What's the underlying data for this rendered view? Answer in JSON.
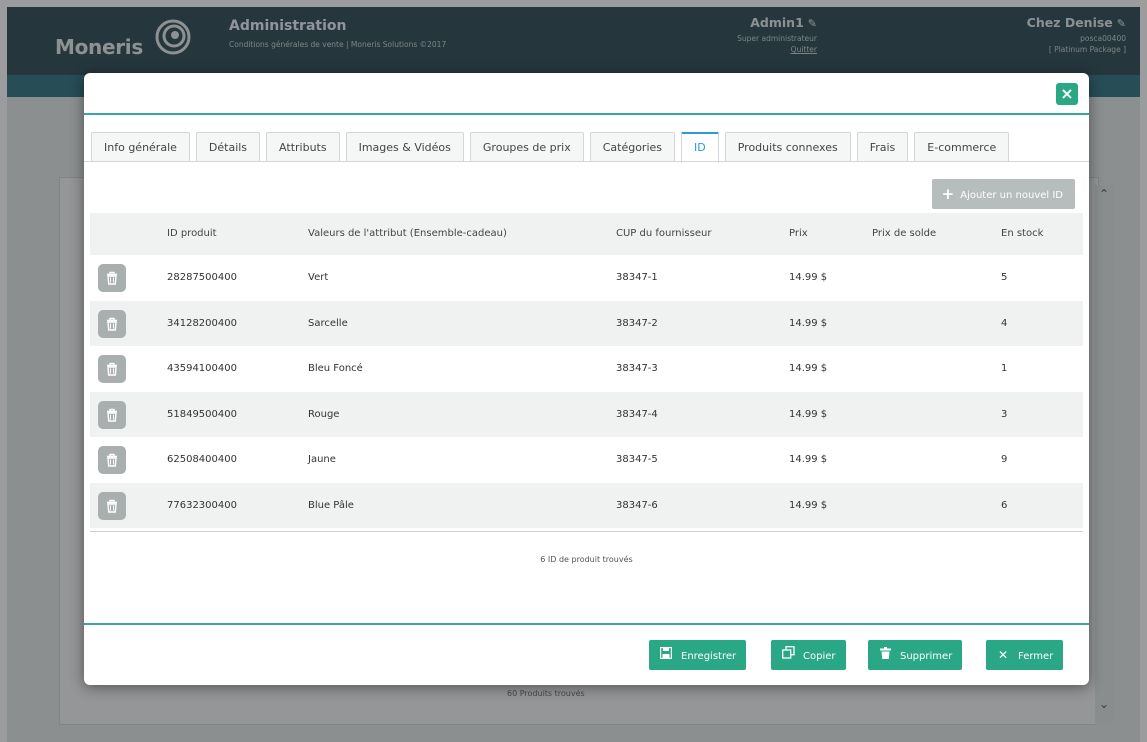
{
  "app": {
    "logo_text": "Moneris",
    "title": "Administration",
    "subtitle": "Conditions générales de vente | Moneris Solutions ©2017",
    "user": {
      "name": "Admin1",
      "role": "Super administrateur",
      "logout": "Quitter"
    },
    "store": {
      "name": "Chez Denise",
      "id": "posca00400",
      "package": "[ Platinum Package ]"
    },
    "background_found": "60 Produits trouvés"
  },
  "modal": {
    "close_label": "×",
    "tabs": [
      {
        "label": "Info générale"
      },
      {
        "label": "Détails"
      },
      {
        "label": "Attributs"
      },
      {
        "label": "Images & Vidéos"
      },
      {
        "label": "Groupes de prix"
      },
      {
        "label": "Catégories"
      },
      {
        "label": "ID",
        "active": true
      },
      {
        "label": "Produits connexes"
      },
      {
        "label": "Frais"
      },
      {
        "label": "E-commerce"
      }
    ],
    "add_button": "Ajouter un nouvel ID",
    "table": {
      "headers": {
        "id": "ID produit",
        "attr": "Valeurs de l'attribut (Ensemble-cadeau)",
        "cup": "CUP du fournisseur",
        "price": "Prix",
        "sale": "Prix de solde",
        "stock": "En stock"
      },
      "rows": [
        {
          "id": "28287500400",
          "attr": "Vert",
          "cup": "38347-1",
          "price": "14.99 $",
          "sale": "",
          "stock": "5"
        },
        {
          "id": "34128200400",
          "attr": "Sarcelle",
          "cup": "38347-2",
          "price": "14.99 $",
          "sale": "",
          "stock": "4"
        },
        {
          "id": "43594100400",
          "attr": "Bleu Foncé",
          "cup": "38347-3",
          "price": "14.99 $",
          "sale": "",
          "stock": "1"
        },
        {
          "id": "51849500400",
          "attr": "Rouge",
          "cup": "38347-4",
          "price": "14.99 $",
          "sale": "",
          "stock": "3"
        },
        {
          "id": "62508400400",
          "attr": "Jaune",
          "cup": "38347-5",
          "price": "14.99 $",
          "sale": "",
          "stock": "9"
        },
        {
          "id": "77632300400",
          "attr": "Blue Pâle",
          "cup": "38347-6",
          "price": "14.99 $",
          "sale": "",
          "stock": "6"
        }
      ],
      "found_text": "6 ID de produit trouvés"
    },
    "footer": {
      "save": "Enregistrer",
      "copy": "Copier",
      "delete": "Supprimer",
      "close": "Fermer"
    }
  },
  "icons": {
    "delete": "trash-icon",
    "close": "close-icon",
    "add": "plus-icon",
    "save": "floppy-disk-icon",
    "copy": "copy-icon",
    "edit": "pencil-icon"
  },
  "colors": {
    "topbar": "#2b4850",
    "accent": "#2aa886",
    "tab_active": "#2a9bd8",
    "disabled_button": "#b7bcbd"
  }
}
